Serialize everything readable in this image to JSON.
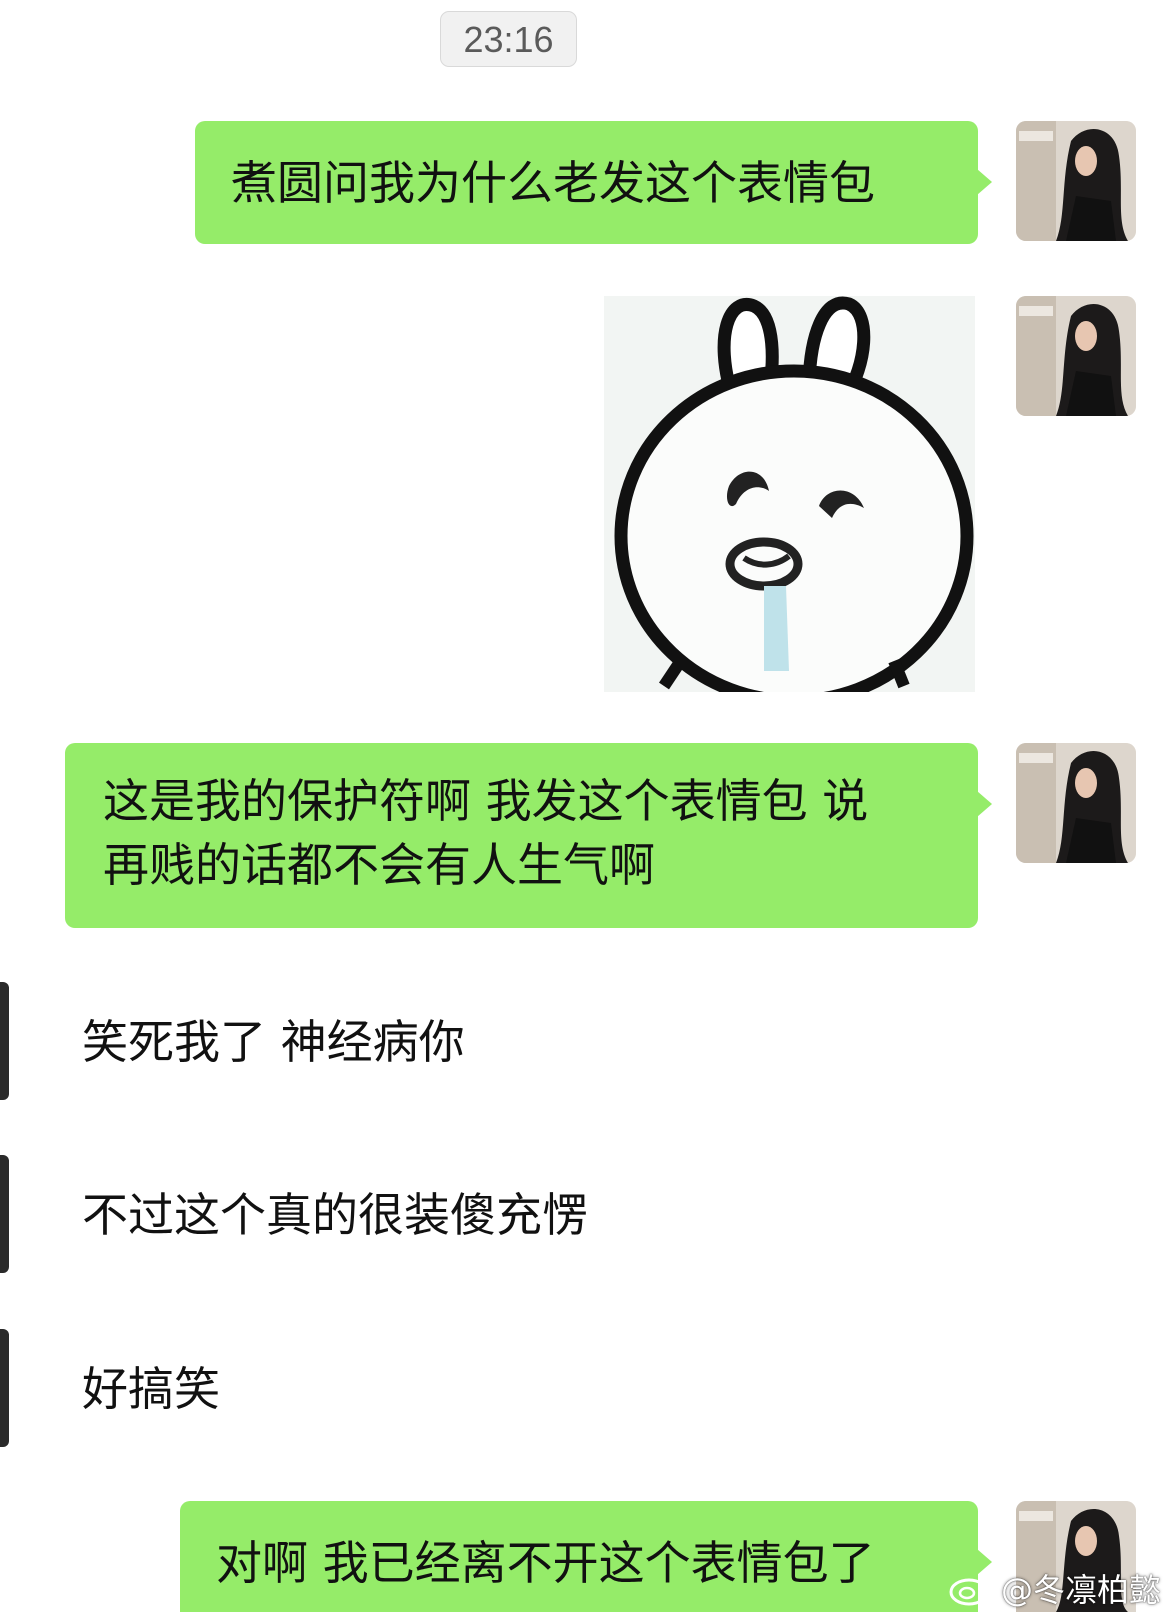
{
  "timestamp": "23:16",
  "colors": {
    "outgoing_bubble": "#95ec69",
    "incoming_bubble": "#ffffff",
    "background": "#ffffff"
  },
  "messages": [
    {
      "side": "outgoing",
      "type": "text",
      "text": "煮圆问我为什么老发这个表情包"
    },
    {
      "side": "outgoing",
      "type": "sticker",
      "sticker": "bunny-face-sticker"
    },
    {
      "side": "outgoing",
      "type": "text",
      "lines": [
        "这是我的保护符啊 我发这个表情包 说",
        "再贱的话都不会有人生气啊"
      ]
    },
    {
      "side": "incoming",
      "type": "text",
      "text": "笑死我了 神经病你"
    },
    {
      "side": "incoming",
      "type": "text",
      "text": "不过这个真的很装傻充愣"
    },
    {
      "side": "incoming",
      "type": "text",
      "text": "好搞笑"
    },
    {
      "side": "outgoing",
      "type": "text",
      "text": "对啊 我已经离不开这个表情包了"
    }
  ],
  "watermark": {
    "icon": "weibo-icon",
    "text": "@冬凛柏懿"
  }
}
